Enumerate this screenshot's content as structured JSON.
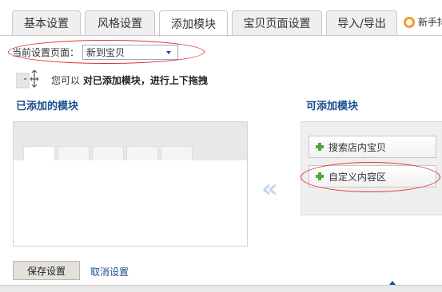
{
  "tabs": [
    {
      "label": "基本设置"
    },
    {
      "label": "风格设置"
    },
    {
      "label": "添加模块"
    },
    {
      "label": "宝贝页面设置"
    },
    {
      "label": "导入/导出"
    }
  ],
  "active_tab": "添加模块",
  "newbie_link": "新手抖",
  "current_page": {
    "label": "当前设置页面：",
    "selected": "新到宝贝"
  },
  "hint": {
    "prefix": "您可以",
    "bold": "对已添加模块，进行上下拖拽"
  },
  "sections": {
    "added_title": "已添加的模块",
    "available_title": "可添加模块"
  },
  "modules": [
    {
      "label": "搜索店内宝贝"
    },
    {
      "label": "自定义内容区"
    }
  ],
  "arrow_glyph": "«",
  "buttons": {
    "save": "保存设置",
    "cancel": "取消设置"
  },
  "colors": {
    "accent_blue": "#1b4e8d",
    "annotation_red": "#dd3333",
    "plus_green": "#4fa83a"
  }
}
